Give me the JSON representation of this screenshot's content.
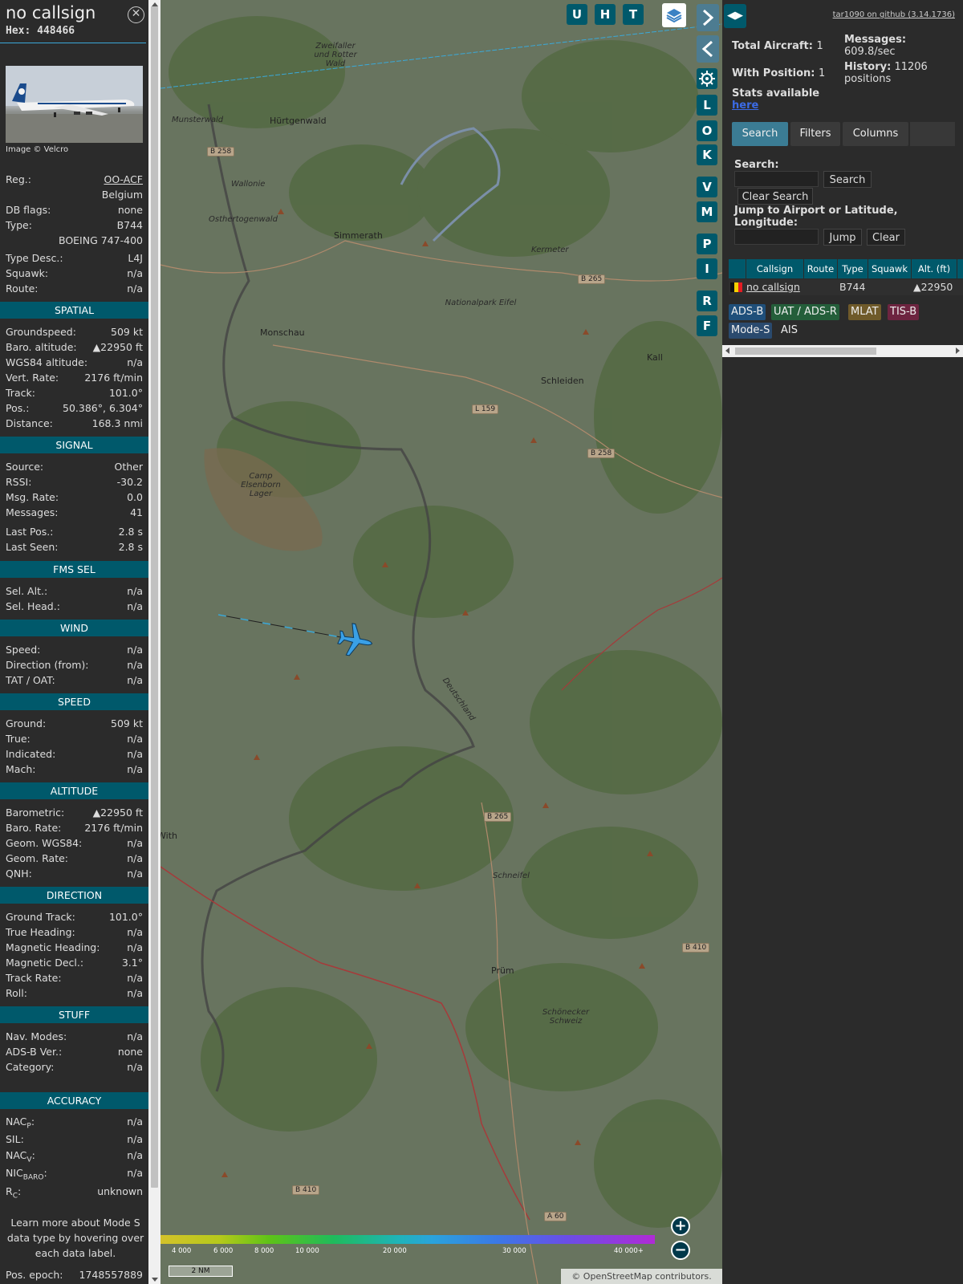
{
  "sidebar": {
    "callsign": "no callsign",
    "hex_label": "Hex:",
    "hex": "448466",
    "close_icon": "close-circle-icon",
    "photo_credit": "Image © Velcro",
    "reg_label": "Reg.:",
    "reg": "OO-ACF",
    "country": "Belgium",
    "dbflags_label": "DB flags:",
    "dbflags": "none",
    "type_label": "Type:",
    "type": "B744",
    "type_full": "BOEING 747-400",
    "typedesc_label": "Type Desc.:",
    "typedesc": "L4J",
    "squawk_label": "Squawk:",
    "squawk": "n/a",
    "route_label": "Route:",
    "route": "n/a",
    "sections": {
      "spatial": "SPATIAL",
      "signal": "SIGNAL",
      "fms": "FMS SEL",
      "wind": "WIND",
      "speed": "SPEED",
      "altitude": "ALTITUDE",
      "direction": "DIRECTION",
      "stuff": "STUFF",
      "accuracy": "ACCURACY"
    },
    "spatial": [
      {
        "k": "Groundspeed:",
        "v": "509 kt"
      },
      {
        "k": "Baro. altitude:",
        "v": "▲22950 ft"
      },
      {
        "k": "WGS84 altitude:",
        "v": "n/a"
      },
      {
        "k": "Vert. Rate:",
        "v": "2176 ft/min"
      },
      {
        "k": "Track:",
        "v": "101.0°"
      },
      {
        "k": "Pos.:",
        "v": "50.386°, 6.304°"
      },
      {
        "k": "Distance:",
        "v": "168.3 nmi"
      }
    ],
    "signal": [
      {
        "k": "Source:",
        "v": "Other"
      },
      {
        "k": "RSSI:",
        "v": "-30.2"
      },
      {
        "k": "Msg. Rate:",
        "v": "0.0"
      },
      {
        "k": "Messages:",
        "v": "41"
      },
      {
        "k": "Last Pos.:",
        "v": "2.8 s"
      },
      {
        "k": "Last Seen:",
        "v": "2.8 s"
      }
    ],
    "fms": [
      {
        "k": "Sel. Alt.:",
        "v": "n/a"
      },
      {
        "k": "Sel. Head.:",
        "v": "n/a"
      }
    ],
    "wind": [
      {
        "k": "Speed:",
        "v": "n/a"
      },
      {
        "k": "Direction (from):",
        "v": "n/a"
      },
      {
        "k": "TAT / OAT:",
        "v": "n/a"
      }
    ],
    "speed": [
      {
        "k": "Ground:",
        "v": "509 kt"
      },
      {
        "k": "True:",
        "v": "n/a"
      },
      {
        "k": "Indicated:",
        "v": "n/a"
      },
      {
        "k": "Mach:",
        "v": "n/a"
      }
    ],
    "altitude": [
      {
        "k": "Barometric:",
        "v": "▲22950 ft"
      },
      {
        "k": "Baro. Rate:",
        "v": "2176 ft/min"
      },
      {
        "k": "Geom. WGS84:",
        "v": "n/a"
      },
      {
        "k": "Geom. Rate:",
        "v": "n/a"
      },
      {
        "k": "QNH:",
        "v": "n/a"
      }
    ],
    "direction": [
      {
        "k": "Ground Track:",
        "v": "101.0°"
      },
      {
        "k": "True Heading:",
        "v": "n/a"
      },
      {
        "k": "Magnetic Heading:",
        "v": "n/a"
      },
      {
        "k": "Magnetic Decl.:",
        "v": "3.1°"
      },
      {
        "k": "Track Rate:",
        "v": "n/a"
      },
      {
        "k": "Roll:",
        "v": "n/a"
      }
    ],
    "stuff": [
      {
        "k": "Nav. Modes:",
        "v": "n/a"
      },
      {
        "k": "ADS-B Ver.:",
        "v": "none"
      },
      {
        "k": "Category:",
        "v": "n/a"
      }
    ],
    "accuracy": {
      "nacp_v": "n/a",
      "sil_label": "SIL:",
      "sil_v": "n/a",
      "nacv_v": "n/a",
      "nicbaro_v": "n/a",
      "rc_v": "unknown"
    },
    "learn_more": "Learn more about Mode S data type by hovering over each data label.",
    "epoch_label": "Pos. epoch:",
    "epoch": "1748557889"
  },
  "map": {
    "buttons": [
      "U",
      "H",
      "T"
    ],
    "side_buttons": [
      "L",
      "O",
      "K",
      "V",
      "M",
      "P",
      "I",
      "R",
      "F"
    ],
    "settings_icon": "gear-icon",
    "layers_icon": "layers-icon",
    "places": [
      {
        "name": "Hürtgenwald",
        "cls": "maplbl"
      },
      {
        "name": "Simmerath",
        "cls": "maplbl"
      },
      {
        "name": "Monschau",
        "cls": "maplbl"
      },
      {
        "name": "Schleiden",
        "cls": "maplbl"
      },
      {
        "name": "Kall",
        "cls": "maplbl"
      },
      {
        "name": "Prüm",
        "cls": "maplbl"
      },
      {
        "name": "Kermeter",
        "cls": "mapital"
      },
      {
        "name": "Nationalpark Eifel",
        "cls": "mapital"
      },
      {
        "name": "Camp Elsenborn Lager",
        "cls": "mapital"
      },
      {
        "name": "Schneifel",
        "cls": "mapital"
      },
      {
        "name": "Schönecker Schweiz",
        "cls": "mapital"
      },
      {
        "name": "Zweifaller und Rotter Wald",
        "cls": "mapital"
      },
      {
        "name": "Osthertogenwald",
        "cls": "mapital"
      },
      {
        "name": "Munsterwald",
        "cls": "mapital"
      },
      {
        "name": "Wallonie",
        "cls": "mapital"
      },
      {
        "name": "Deutschland",
        "cls": "mapital"
      },
      {
        "name": "With",
        "cls": "maplbl"
      }
    ],
    "roads": [
      "B 258",
      "B 265",
      "L 159",
      "B 258",
      "B 265",
      "B 410",
      "B 410",
      "A 60"
    ],
    "color_legend": [
      "4 000",
      "6 000",
      "8 000",
      "10 000",
      "20 000",
      "30 000",
      "40 000+"
    ],
    "scale": "2 NM",
    "attribution": "© OpenStreetMap contributors."
  },
  "panel": {
    "github": "tar1090 on github (3.14.1736)",
    "total_label": "Total Aircraft:",
    "total": "1",
    "withpos_label": "With Position:",
    "withpos": "1",
    "messages_label": "Messages:",
    "messages": "609.8/sec",
    "history_label": "History:",
    "history": "11206",
    "history_unit": "positions",
    "stats_label": "Stats available",
    "stats_link": "here",
    "tabs": [
      "Search",
      "Filters",
      "Columns"
    ],
    "search_label": "Search:",
    "search_btn": "Search",
    "clear_search_btn": "Clear Search",
    "jump_label": "Jump to Airport or Latitude, Longitude:",
    "jump_btn": "Jump",
    "clear_btn": "Clear",
    "columns": [
      "Callsign",
      "Route",
      "Type",
      "Squawk",
      "Alt. (ft)"
    ],
    "row": {
      "callsign": "no callsign",
      "route": "",
      "type": "B744",
      "squawk": "",
      "alt": "▲22950"
    },
    "chips": [
      {
        "label": "ADS-B",
        "color": "#1f4f7a"
      },
      {
        "label": "UAT / ADS-R",
        "color": "#245e3a"
      },
      {
        "label": "MLAT",
        "color": "#6f5a2a"
      },
      {
        "label": "TIS-B",
        "color": "#6d2440"
      },
      {
        "label": "Mode-S",
        "color": "#2a4a6e"
      },
      {
        "label": "AIS",
        "color": "#2b2b2b"
      }
    ]
  }
}
